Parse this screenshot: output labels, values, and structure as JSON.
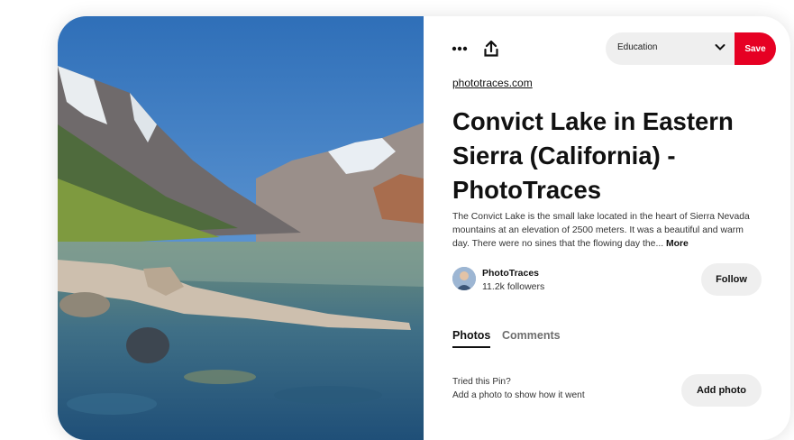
{
  "toolbar": {
    "more_icon": "ellipsis-icon",
    "share_icon": "upload-icon",
    "board_value": "Education",
    "save_label": "Save"
  },
  "pin": {
    "source": "phototraces.com",
    "title": "Convict Lake in Eastern Sierra (California) - PhotoTraces",
    "description": "The Convict Lake is the small lake located in the heart of Sierra Nevada mountains at an elevation of 2500 meters. It was a beautiful and warm day. There were no sines that the flowing day the...",
    "more_label": "More"
  },
  "author": {
    "name": "PhotoTraces",
    "followers": "11.2k followers",
    "follow_label": "Follow"
  },
  "tabs": [
    {
      "label": "Photos"
    },
    {
      "label": "Comments"
    }
  ],
  "tried": {
    "line1": "Tried this Pin?",
    "line2": "Add a photo to show how it went",
    "button_label": "Add photo"
  },
  "colors": {
    "save_red": "#e60023",
    "button_gray": "#efefef"
  }
}
